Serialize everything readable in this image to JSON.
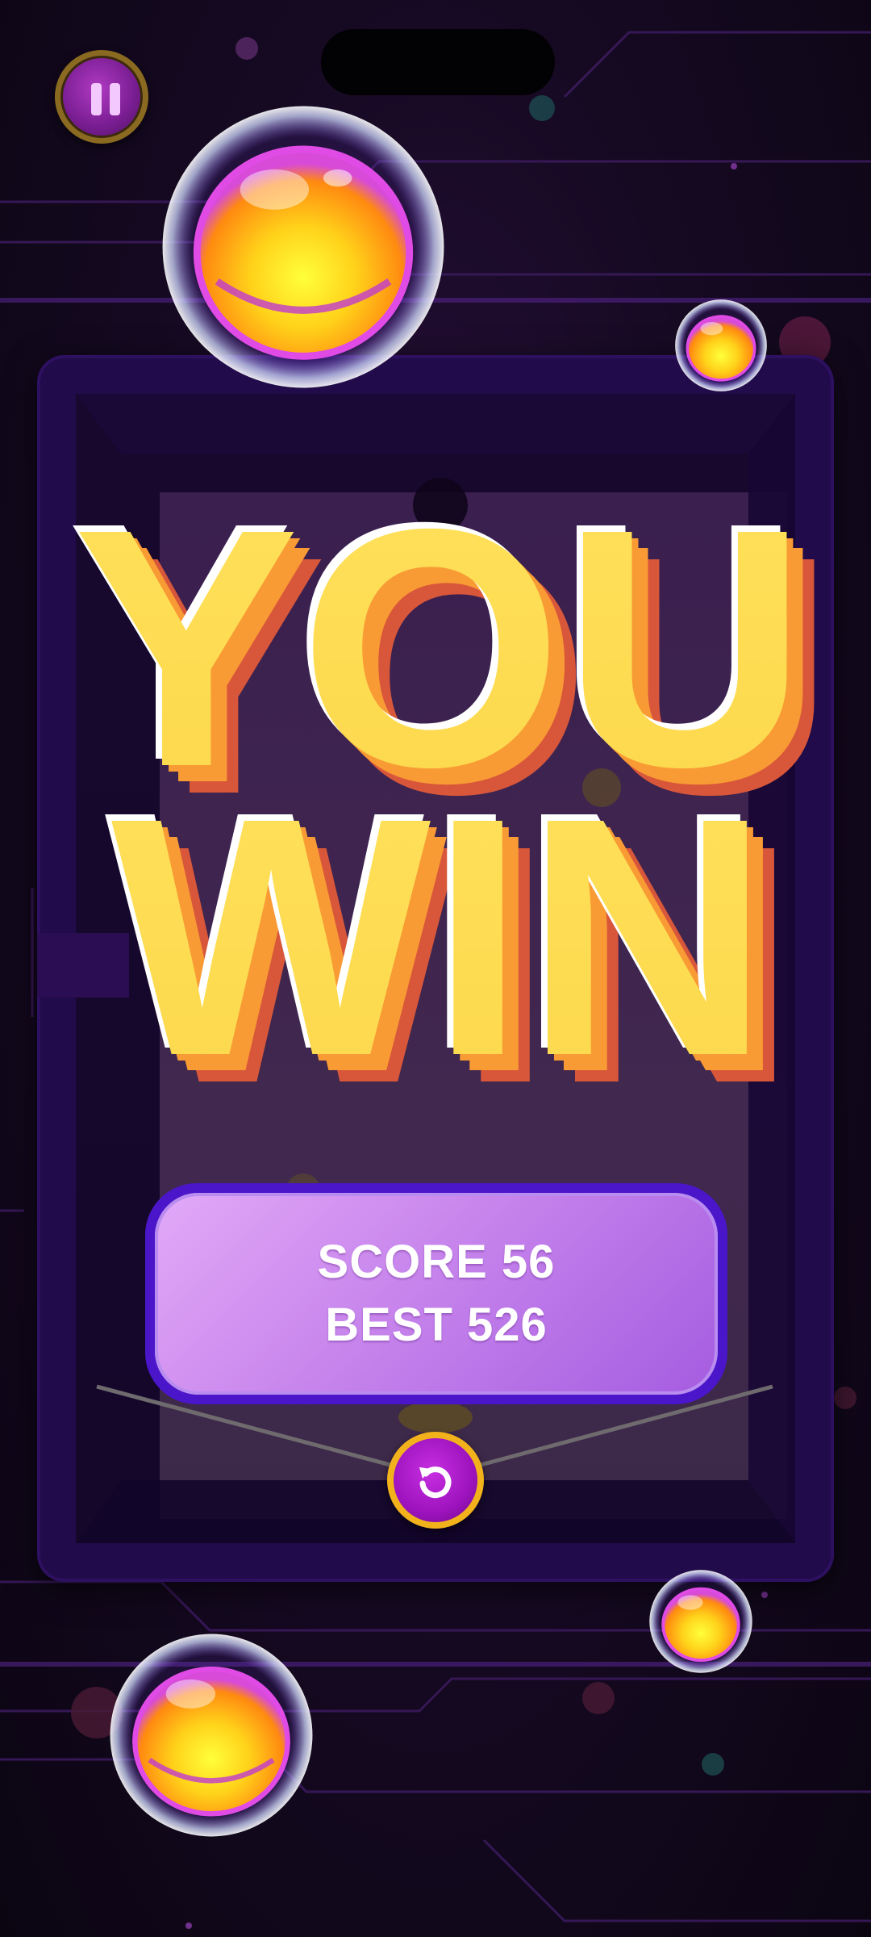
{
  "game": {
    "title_line_1": "YOU",
    "title_line_2": "WIN",
    "score_label": "SCORE 56",
    "best_label": "BEST 526"
  },
  "controls": {
    "pause_icon": "pause-icon",
    "restart_icon": "restart-icon"
  },
  "colors": {
    "title_face": "#fddf52",
    "title_side": "#f99b34",
    "title_shadow": "#d8573a",
    "panel_top": "#e2a9f7",
    "panel_border": "#4b16c9",
    "button_gold": "#f2b21c",
    "button_purple": "#9d13be"
  }
}
